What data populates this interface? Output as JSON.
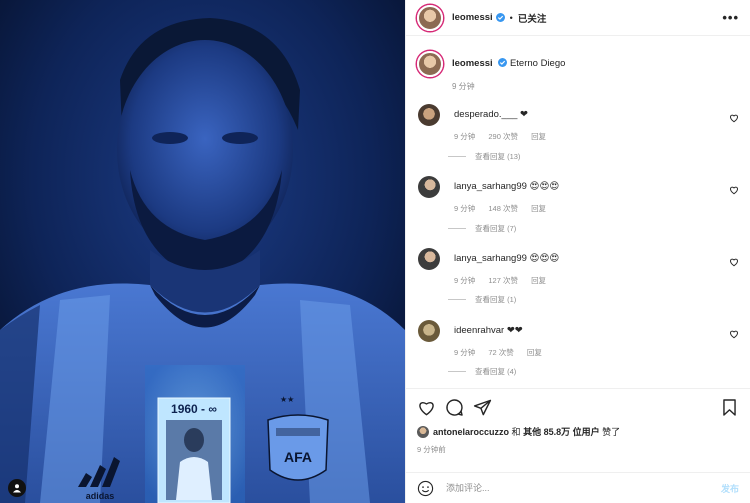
{
  "header": {
    "username": "leomessi",
    "separator": "•",
    "follow_state": "已关注",
    "more_label": "•••"
  },
  "caption": {
    "username": "leomessi",
    "text": "Eterno Diego",
    "time": "9 分钟"
  },
  "comments": [
    {
      "username": "desperado.___",
      "text": "❤",
      "time": "9 分钟",
      "likes": "290 次赞",
      "reply_label": "回复",
      "view_replies": "查看回复 (13)"
    },
    {
      "username": "lanya_sarhang99",
      "text": "😍😍😍",
      "time": "9 分钟",
      "likes": "148 次赞",
      "reply_label": "回复",
      "view_replies": "查看回复 (7)"
    },
    {
      "username": "lanya_sarhang99",
      "text": "😍😍😍",
      "time": "9 分钟",
      "likes": "127 次赞",
      "reply_label": "回复",
      "view_replies": "查看回复 (1)"
    },
    {
      "username": "ideenrahvar",
      "text": "❤❤",
      "time": "9 分钟",
      "likes": "72 次赞",
      "reply_label": "回复",
      "view_replies": "查看回复 (4)"
    }
  ],
  "likes_line": {
    "user": "antonelaroccuzzo",
    "and": "和",
    "others": "其他 85.8万 位用户",
    "suffix": "赞了"
  },
  "post_time": "9 分钟前",
  "add_comment": {
    "placeholder": "添加评论...",
    "post_label": "发布"
  },
  "photo": {
    "card_text": "1960 - ∞",
    "badge_text": "AFA"
  },
  "colors": {
    "accent": "#0095f6",
    "story_ring": "#d62976",
    "post_disabled": "#b2dffc",
    "photo_base": "#0a1a3a"
  }
}
